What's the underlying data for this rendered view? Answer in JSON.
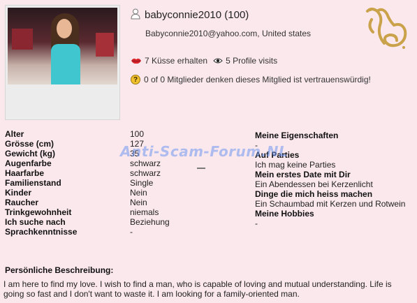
{
  "profile": {
    "username": "babyconnie2010 (100)",
    "contact": "Babyconnie2010@yahoo.com, United states",
    "kisses": "7 Küsse erhalten",
    "visits": "5 Profile visits",
    "trust": "0 of 0 Mitglieder denken dieses Mitglied ist vertrauenswürdig!"
  },
  "watermark": "Anti-Scam-Forum.NL",
  "attributes": [
    {
      "label": "Alter",
      "value": "100"
    },
    {
      "label": "Grösse (cm)",
      "value": "127"
    },
    {
      "label": "Gewicht (kg)",
      "value": "35"
    },
    {
      "label": "Augenfarbe",
      "value": "schwarz"
    },
    {
      "label": "Haarfarbe",
      "value": "schwarz"
    },
    {
      "label": "Familienstand",
      "value": "Single"
    },
    {
      "label": "Kinder",
      "value": "Nein"
    },
    {
      "label": "Raucher",
      "value": "Nein"
    },
    {
      "label": "Trinkgewohnheit",
      "value": "niemals"
    },
    {
      "label": "Ich suche nach",
      "value": "Beziehung"
    },
    {
      "label": "Sprachkenntnisse",
      "value": "-"
    }
  ],
  "details": [
    {
      "heading": "Meine Eigenschaften",
      "value": "-"
    },
    {
      "heading": "Auf Parties",
      "value": "Ich mag keine Parties"
    },
    {
      "heading": "Mein erstes Date mit Dir",
      "value": "Ein Abendessen bei Kerzenlicht"
    },
    {
      "heading": "Dinge die mich heiss machen",
      "value": "Ein Schaumbad mit Kerzen und Rotwein"
    },
    {
      "heading": "Meine Hobbies",
      "value": "-"
    }
  ],
  "description": {
    "heading": "Persönliche Beschreibung:",
    "text": "I am here to find my love. I wish to find a man, who is capable of loving and mutual understanding. Life is going so fast and I don't want to waste it. I am looking for a family-oriented man."
  },
  "colors": {
    "background": "#fbe8ec",
    "zodiac_gold": "#c9a24a"
  }
}
